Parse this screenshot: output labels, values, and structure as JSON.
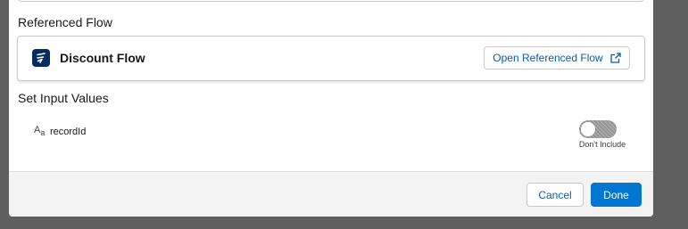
{
  "colors": {
    "overlay": "#5f5f5f",
    "brand_blue": "#0176d3",
    "link_blue": "#0b5cab",
    "flow_icon_bg": "#032d60",
    "footer_bg": "#f3f3f3"
  },
  "referenced_flow": {
    "section_label": "Referenced Flow",
    "flow_name": "Discount Flow",
    "flow_icon": "flow-icon",
    "open_button_label": "Open Referenced Flow",
    "open_button_icon": "external-link-icon"
  },
  "input_values": {
    "section_label": "Set Input Values",
    "variables": [
      {
        "type_icon": "text-type-icon",
        "type_icon_big": "A",
        "type_icon_small": "a",
        "name": "recordId",
        "include_toggle": {
          "state": "off",
          "label": "Don't Include"
        }
      }
    ]
  },
  "footer": {
    "cancel_label": "Cancel",
    "done_label": "Done"
  }
}
